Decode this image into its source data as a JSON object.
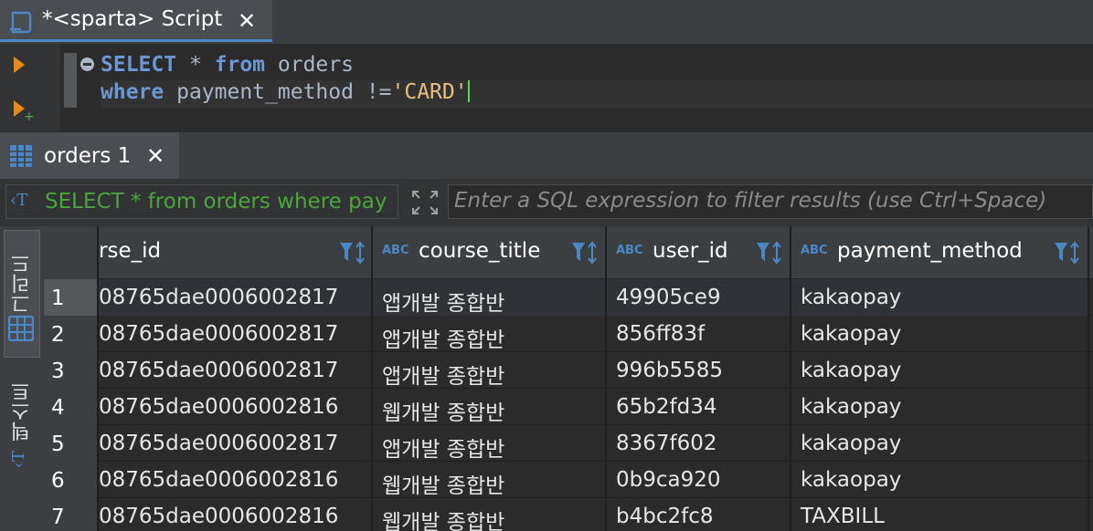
{
  "editor_tab": {
    "title": "*<sparta> Script",
    "close": "✕",
    "icon": "script-icon"
  },
  "editor": {
    "line1": {
      "kw1": "SELECT",
      "star": " * ",
      "kw2": "from",
      "rest": " orders"
    },
    "line2": {
      "kw1": "where",
      "rest": " payment_method !=",
      "str": "'CARD'"
    }
  },
  "results_tab": {
    "title": "orders 1",
    "close": "✕",
    "icon": "grid-icon"
  },
  "filter": {
    "query_text": "SELECT * from orders where pay",
    "placeholder": "Enter a SQL expression to filter results (use Ctrl+Space)"
  },
  "sidebar": {
    "grid_label": "그리드",
    "text_label": "텍스트"
  },
  "table": {
    "columns": [
      {
        "type_badge": "",
        "name": "rse_id"
      },
      {
        "type_badge": "ABC",
        "name": "course_title"
      },
      {
        "type_badge": "ABC",
        "name": "user_id"
      },
      {
        "type_badge": "ABC",
        "name": "payment_method"
      }
    ],
    "rows": [
      {
        "num": "1",
        "c1": "08765dae0006002817",
        "c2": "앱개발 종합반",
        "c3": "49905ce9",
        "c4": "kakaopay"
      },
      {
        "num": "2",
        "c1": "08765dae0006002817",
        "c2": "앱개발 종합반",
        "c3": "856ff83f",
        "c4": "kakaopay"
      },
      {
        "num": "3",
        "c1": "08765dae0006002817",
        "c2": "앱개발 종합반",
        "c3": "996b5585",
        "c4": "kakaopay"
      },
      {
        "num": "4",
        "c1": "08765dae0006002816",
        "c2": "웹개발 종합반",
        "c3": "65b2fd34",
        "c4": "kakaopay"
      },
      {
        "num": "5",
        "c1": "08765dae0006002817",
        "c2": "앱개발 종합반",
        "c3": "8367f602",
        "c4": "kakaopay"
      },
      {
        "num": "6",
        "c1": "08765dae0006002816",
        "c2": "웹개발 종합반",
        "c3": "0b9ca920",
        "c4": "kakaopay"
      },
      {
        "num": "7",
        "c1": "08765dae0006002816",
        "c2": "웹개발 종합반",
        "c3": "b4bc2fc8",
        "c4": "TAXBILL"
      }
    ]
  },
  "colors": {
    "accent": "#4a88c7",
    "keyword": "#6b97d4",
    "string": "#e6c07b",
    "run": "#e88a1a",
    "query_green": "#4aa63a"
  }
}
